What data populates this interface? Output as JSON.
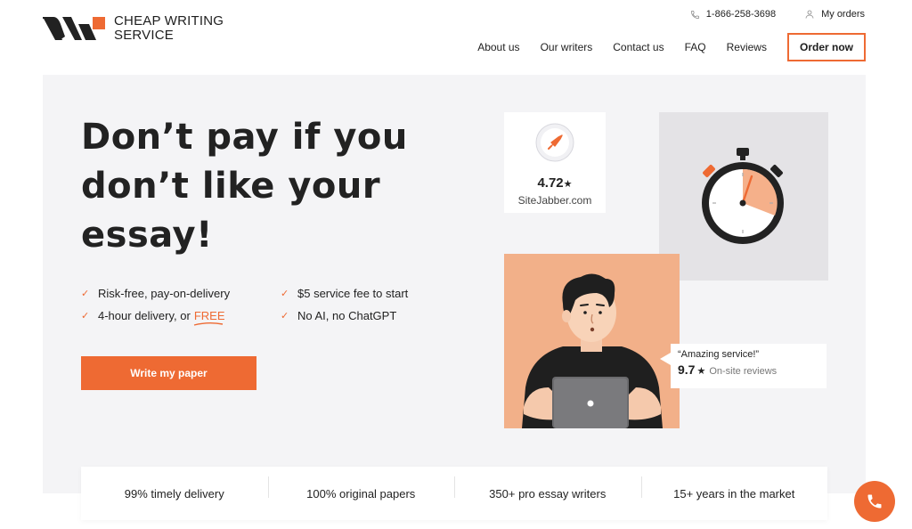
{
  "brand": {
    "name_line1": "CHEAP WRITING",
    "name_line2": "SERVICE",
    "accent_color": "#ee6a33"
  },
  "top_links": {
    "phone": "1-866-258-3698",
    "phone_icon": "phone-icon",
    "orders": "My orders",
    "orders_icon": "user-icon"
  },
  "nav": {
    "items": [
      "About us",
      "Our writers",
      "Contact us",
      "FAQ",
      "Reviews"
    ],
    "order_button": "Order now"
  },
  "hero": {
    "headline": [
      "Don’t pay if you",
      "don’t like your",
      "essay!"
    ],
    "features": [
      {
        "text": "Risk-free, pay-on-delivery"
      },
      {
        "text": "$5 service fee to start"
      },
      {
        "text": "4-hour delivery, or",
        "highlight": "FREE"
      },
      {
        "text": "No AI, no ChatGPT"
      }
    ],
    "cta": "Write my paper"
  },
  "sitejabber": {
    "rating": "4.72",
    "star": "★",
    "site": "SiteJabber.com",
    "icon": "rocket-icon"
  },
  "timer": {
    "icon": "stopwatch-icon"
  },
  "review": {
    "quote": "“Amazing service!”",
    "score": "9.7",
    "star": "★",
    "label": "On-site reviews"
  },
  "stats": [
    "99% timely delivery",
    "100% original papers",
    "350+ pro essay writers",
    "15+ years in the market"
  ],
  "fab": {
    "icon": "phone-icon"
  }
}
